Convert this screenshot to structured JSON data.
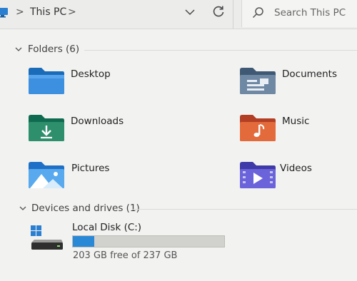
{
  "address_bar": {
    "breadcrumb_sep1": ">",
    "location": "This PC",
    "breadcrumb_sep2": ">",
    "dropdown_icon": "chevron-down-icon",
    "refresh_icon": "refresh-icon"
  },
  "search": {
    "placeholder": "Search This PC"
  },
  "folders_section": {
    "title": "Folders (6)",
    "items": [
      {
        "label": "Desktop",
        "icon": "desktop-folder-icon"
      },
      {
        "label": "Documents",
        "icon": "documents-folder-icon"
      },
      {
        "label": "Downloads",
        "icon": "downloads-folder-icon"
      },
      {
        "label": "Music",
        "icon": "music-folder-icon"
      },
      {
        "label": "Pictures",
        "icon": "pictures-folder-icon"
      },
      {
        "label": "Videos",
        "icon": "videos-folder-icon"
      }
    ]
  },
  "drives_section": {
    "title": "Devices and drives (1)",
    "drives": [
      {
        "label": "Local Disk (C:)",
        "free_text": "203 GB free of 237 GB",
        "used_fraction": 0.14
      }
    ]
  },
  "colors": {
    "usage_bar": "#2a89d6",
    "usage_bar_track": "#d1d1ce"
  }
}
